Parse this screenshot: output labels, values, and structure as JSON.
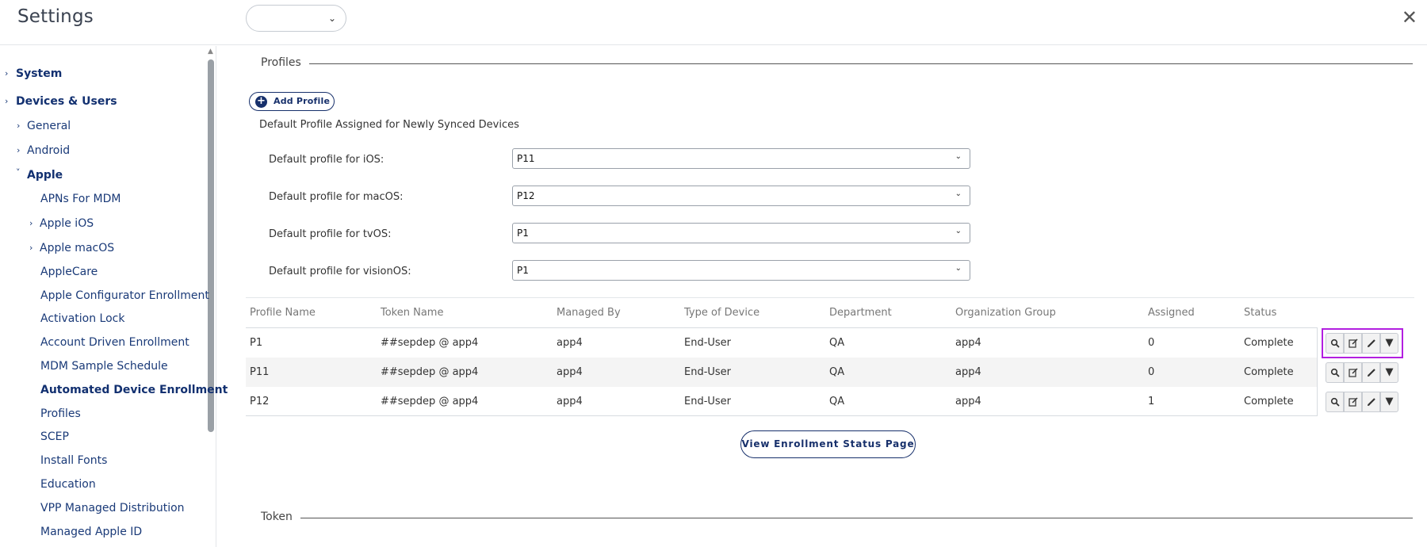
{
  "app": {
    "title": "Settings",
    "close_icon": "close-icon",
    "top_select_value": ""
  },
  "sidebar": {
    "items": [
      {
        "label": "System",
        "bold": true,
        "caret": "›"
      },
      {
        "label": "Devices & Users",
        "bold": true,
        "caret": "›"
      },
      {
        "label": "General",
        "caret": "›"
      },
      {
        "label": "Android",
        "caret": "›"
      },
      {
        "label": "Apple",
        "bold": true,
        "caret": "˅"
      },
      {
        "label": "APNs For MDM"
      },
      {
        "label": "Apple iOS",
        "caret": "›"
      },
      {
        "label": "Apple macOS",
        "caret": "›"
      },
      {
        "label": "AppleCare"
      },
      {
        "label": "Apple Configurator Enrollment"
      },
      {
        "label": "Activation Lock"
      },
      {
        "label": "Account Driven Enrollment"
      },
      {
        "label": "MDM Sample Schedule"
      },
      {
        "label": "Automated Device Enrollment",
        "bold": true
      },
      {
        "label": "Profiles"
      },
      {
        "label": "SCEP"
      },
      {
        "label": "Install Fonts"
      },
      {
        "label": "Education"
      },
      {
        "label": "VPP Managed Distribution"
      },
      {
        "label": "Managed Apple ID"
      }
    ]
  },
  "main": {
    "profiles_section": "Profiles",
    "add_profile_label": "Add Profile",
    "default_heading": "Default Profile Assigned for Newly Synced Devices",
    "defaults": [
      {
        "label": "Default profile for iOS:",
        "value": "P11"
      },
      {
        "label": "Default profile for macOS:",
        "value": "P12"
      },
      {
        "label": "Default profile for tvOS:",
        "value": "P1"
      },
      {
        "label": "Default profile for visionOS:",
        "value": "P1"
      }
    ],
    "table": {
      "columns": [
        "Profile Name",
        "Token Name",
        "Managed By",
        "Type of Device",
        "Department",
        "Organization Group",
        "Assigned",
        "Status"
      ],
      "rows": [
        [
          "P1",
          "##sepdep @ app4",
          "app4",
          "End-User",
          "QA",
          "app4",
          "0",
          "Complete"
        ],
        [
          "P11",
          "##sepdep @ app4",
          "app4",
          "End-User",
          "QA",
          "app4",
          "0",
          "Complete"
        ],
        [
          "P12",
          "##sepdep @ app4",
          "app4",
          "End-User",
          "QA",
          "app4",
          "1",
          "Complete"
        ]
      ],
      "action_icons": [
        "search-icon",
        "edit-box-icon",
        "pencil-icon",
        "dropdown-arrow-icon"
      ]
    },
    "view_enrollment_label": "View Enrollment Status Page",
    "token_section": "Token"
  },
  "colors": {
    "accent": "#17306b",
    "highlight": "#b21fe0"
  }
}
